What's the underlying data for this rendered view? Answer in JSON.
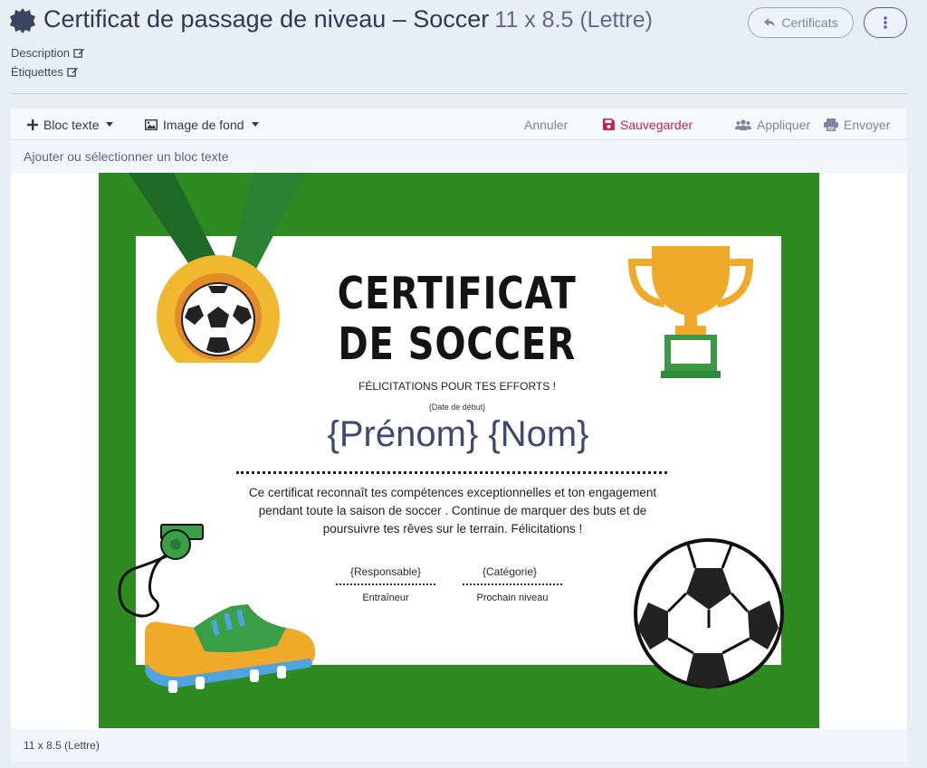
{
  "header": {
    "title": "Certificat de passage de niveau – Soccer",
    "format": "11 x 8.5 (Lettre)",
    "description_link": "Description",
    "tags_link": "Étiquettes",
    "back_button": "Certificats"
  },
  "toolbar": {
    "text_block": "Bloc texte",
    "background_image": "Image de fond",
    "cancel": "Annuler",
    "save": "Sauvegarder",
    "apply": "Appliquer",
    "send": "Envoyer"
  },
  "hint": "Ajouter ou sélectionner un bloc texte",
  "certificate": {
    "title_line1": "CERTIFICAT",
    "title_line2": "DE SOCCER",
    "subtitle": "FÉLICITATIONS POUR TES EFFORTS !",
    "start_date": "{Date de début}",
    "name": "{Prénom} {Nom}",
    "body": "Ce certificat reconnaît tes compétences exceptionnelles et ton engagement pendant toute la saison de soccer . Continue de marquer des buts et de poursuivre tes rêves sur le terrain. Félicitations !",
    "sig_left_field": "{Responsable}",
    "sig_left_label": "Entraîneur",
    "sig_right_field": "{Catégorie}",
    "sig_right_label": "Prochain niveau"
  },
  "footer": "11 x 8.5 (Lettre)",
  "colors": {
    "frame_green": "#2e8b22",
    "save_red": "#c6254b",
    "kebab_blue": "#3d64b8"
  },
  "icons": [
    "badge-icon",
    "edit-icon",
    "plus-icon",
    "image-icon",
    "save-icon",
    "users-icon",
    "send-icon",
    "reply-icon",
    "kebab-icon"
  ]
}
